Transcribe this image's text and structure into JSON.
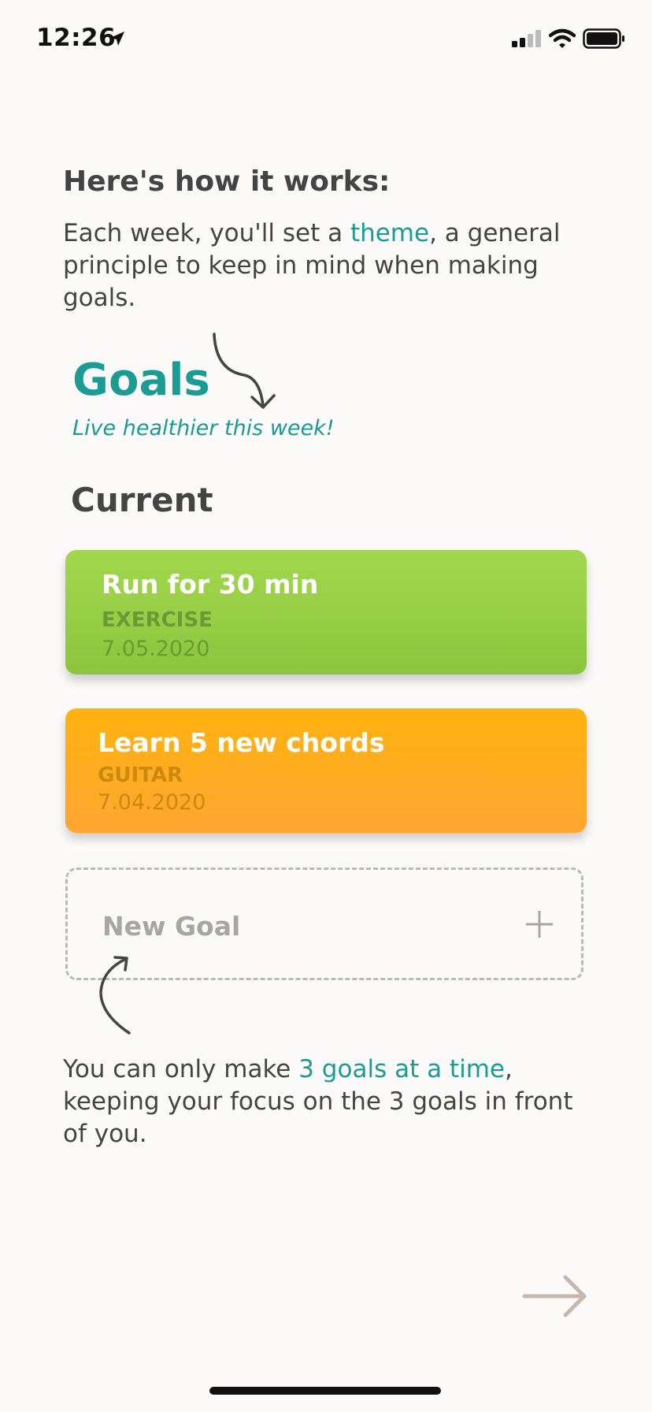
{
  "status_bar": {
    "time": "12:26"
  },
  "intro": {
    "title": "Here's how it works:",
    "text_before": "Each week, you'll set a ",
    "text_accent": "theme",
    "text_after": ", a general principle to keep in mind when making goals."
  },
  "goals": {
    "title": "Goals",
    "theme": "Live healthier this week!",
    "section_title": "Current",
    "cards": [
      {
        "title": "Run for 30 min",
        "category": "EXERCISE",
        "date": "7.05.2020",
        "color": "#9bd048"
      },
      {
        "title": "Learn 5 new chords",
        "category": "GUITAR",
        "date": "7.04.2020",
        "color": "#ffad1f"
      }
    ],
    "new_goal_label": "New Goal"
  },
  "bottom": {
    "text_before": "You can only make ",
    "text_accent": "3 goals at a time",
    "text_after": ", keeping your focus on the 3 goals in front of you."
  },
  "colors": {
    "accent": "#1a9c92",
    "background": "#fcfaf8"
  },
  "icons": [
    "location-arrow-icon",
    "signal-icon",
    "wifi-icon",
    "battery-icon",
    "curved-arrow-icon",
    "plus-icon",
    "next-arrow-icon"
  ]
}
